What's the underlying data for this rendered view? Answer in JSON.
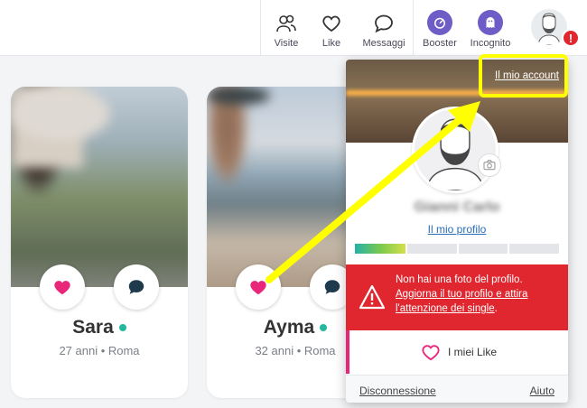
{
  "nav": {
    "visite": "Visite",
    "like": "Like",
    "messaggi": "Messaggi",
    "booster": "Booster",
    "incognito": "Incognito",
    "alert_badge": "!"
  },
  "profiles": [
    {
      "name": "Sara",
      "meta": "27 anni • Roma"
    },
    {
      "name": "Ayma",
      "meta": "32 anni • Roma"
    }
  ],
  "dropdown": {
    "account_link": "Il mio account",
    "username": "Gianni Carlo",
    "profile_link": "Il mio profilo",
    "progress": 0.25,
    "alert": {
      "line1": "Non hai una foto del profilo.",
      "line2": "Aggiorna il tuo profilo e attira",
      "line3_link": "l'attenzione dei single",
      "line3_tail": "."
    },
    "likes_label": "I miei Like",
    "logout": "Disconnessione",
    "help": "Aiuto"
  },
  "colors": {
    "accent_purple": "#6e5dc6",
    "like_pink": "#e8277a",
    "alert_red": "#e0262e",
    "online_green": "#22b8a0",
    "annotation_yellow": "#ffff00"
  }
}
